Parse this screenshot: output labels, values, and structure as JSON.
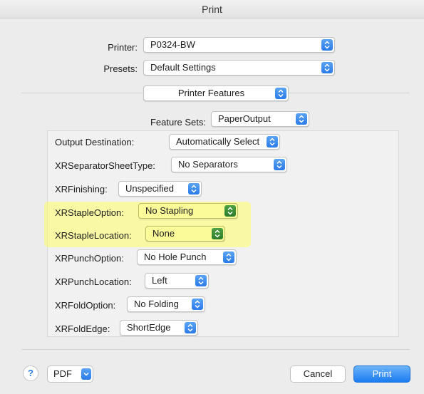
{
  "window": {
    "title": "Print"
  },
  "printer": {
    "label": "Printer:",
    "value": "P0324-BW"
  },
  "presets": {
    "label": "Presets:",
    "value": "Default Settings"
  },
  "section": {
    "value": "Printer Features"
  },
  "feature_sets": {
    "label": "Feature Sets:",
    "value": "PaperOutput"
  },
  "options": [
    {
      "label": "Output Destination:",
      "value": "Automatically Select"
    },
    {
      "label": "XRSeparatorSheetType:",
      "value": "No Separators"
    },
    {
      "label": "XRFinishing:",
      "value": "Unspecified"
    },
    {
      "label": "XRStapleOption:",
      "value": "No Stapling"
    },
    {
      "label": "XRStapleLocation:",
      "value": "None"
    },
    {
      "label": "XRPunchOption:",
      "value": "No Hole Punch"
    },
    {
      "label": "XRPunchLocation:",
      "value": "Left"
    },
    {
      "label": "XRFoldOption:",
      "value": "No Folding"
    },
    {
      "label": "XRFoldEdge:",
      "value": "ShortEdge"
    }
  ],
  "footer": {
    "help": "?",
    "pdf": "PDF",
    "cancel": "Cancel",
    "print": "Print"
  },
  "colors": {
    "accent": "#2a7ae8",
    "highlight": "#ffff66"
  },
  "icons": {
    "popup": "up-down-chevron-icon",
    "pdf_menu": "chevron-down-icon",
    "help": "help-icon"
  }
}
